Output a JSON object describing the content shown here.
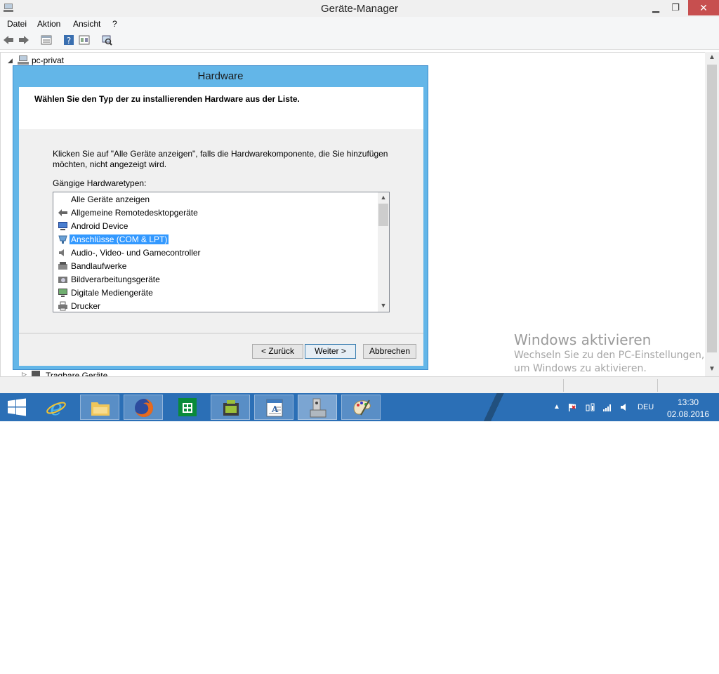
{
  "window": {
    "title": "Geräte-Manager"
  },
  "menu": [
    "Datei",
    "Aktion",
    "Ansicht",
    "?"
  ],
  "tree": {
    "root": "pc-privat",
    "partial_item": "Tragbare Geräte"
  },
  "dialog": {
    "title": "Hardware",
    "header": "Wählen Sie den Typ der zu installierenden Hardware aus der Liste.",
    "instruction_line1": "Klicken Sie auf \"Alle Geräte anzeigen\", falls die Hardwarekomponente, die Sie hinzufügen",
    "instruction_line2": "möchten, nicht angezeigt wird.",
    "list_label": "Gängige Hardwaretypen:",
    "list_items": [
      {
        "label": "Alle Geräte anzeigen",
        "icon": "none"
      },
      {
        "label": "Allgemeine Remotedesktopgeräte",
        "icon": "remote-desktop-icon"
      },
      {
        "label": "Android Device",
        "icon": "android-device-icon"
      },
      {
        "label": "Anschlüsse (COM & LPT)",
        "icon": "port-icon"
      },
      {
        "label": "Audio-, Video- und Gamecontroller",
        "icon": "speaker-icon"
      },
      {
        "label": "Bandlaufwerke",
        "icon": "tape-drive-icon"
      },
      {
        "label": "Bildverarbeitungsgeräte",
        "icon": "camera-icon"
      },
      {
        "label": "Digitale Mediengeräte",
        "icon": "media-device-icon"
      },
      {
        "label": "Drucker",
        "icon": "printer-icon"
      }
    ],
    "selected_index": 3,
    "buttons": {
      "back": "< Zurück",
      "next": "Weiter >",
      "cancel": "Abbrechen"
    }
  },
  "watermark": {
    "title": "Windows aktivieren",
    "line1": "Wechseln Sie zu den PC-Einstellungen,",
    "line2": "um Windows zu aktivieren."
  },
  "taskbar": {
    "apps": [
      "windows-start-icon",
      "internet-explorer-icon",
      "file-explorer-icon",
      "firefox-icon",
      "store-icon",
      "android-icon",
      "wordpad-icon",
      "device-manager-icon",
      "paint-icon"
    ],
    "language": "DEU",
    "time": "13:30",
    "date": "02.08.2016"
  },
  "colors": {
    "taskbar": "#2b6fb6",
    "dialog_border": "#63b6e8",
    "selection": "#3399ff",
    "close_button": "#c74f4f"
  }
}
